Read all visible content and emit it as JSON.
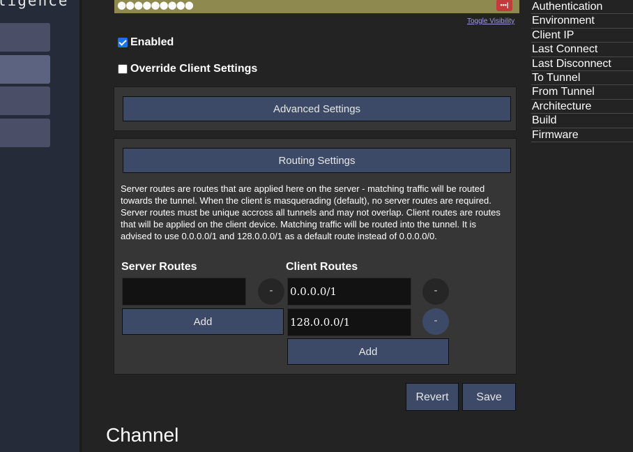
{
  "sidebar": {
    "brand": "ligence"
  },
  "auth": {
    "password_masked": "●●●●●●●●●",
    "key_badge": "•••|",
    "toggle_visibility": "Toggle Visibility"
  },
  "options": {
    "enabled_label": "Enabled",
    "enabled_checked": true,
    "override_label": "Override Client Settings",
    "override_checked": false
  },
  "advanced": {
    "button_label": "Advanced Settings"
  },
  "routing": {
    "button_label": "Routing Settings",
    "description": "Server routes are routes that are applied here on the server - matching traffic will be routed towards the tunnel. When the client is masquerading (default), no server routes are required. Server routes must be unique accross all tunnels and may not overlap. Client routes are routes that will be applied on the client device. Matching traffic will be routed into the tunnel. It is advised to use 0.0.0.0/1 and 128.0.0.0/1 as a default route instead of 0.0.0.0/0.",
    "server_title": "Server Routes",
    "client_title": "Client Routes",
    "server_routes": [
      ""
    ],
    "client_routes": [
      "0.0.0.0/1",
      "128.0.0.0/1"
    ],
    "remove_label": "-",
    "add_label": "Add"
  },
  "actions": {
    "revert_label": "Revert",
    "save_label": "Save"
  },
  "channel": {
    "title": "Channel"
  },
  "info_list": [
    "Authentication",
    "Environment",
    "Client IP",
    "Last Connect",
    "Last Disconnect",
    "To Tunnel",
    "From Tunnel",
    "Architecture",
    "Build",
    "Firmware"
  ]
}
